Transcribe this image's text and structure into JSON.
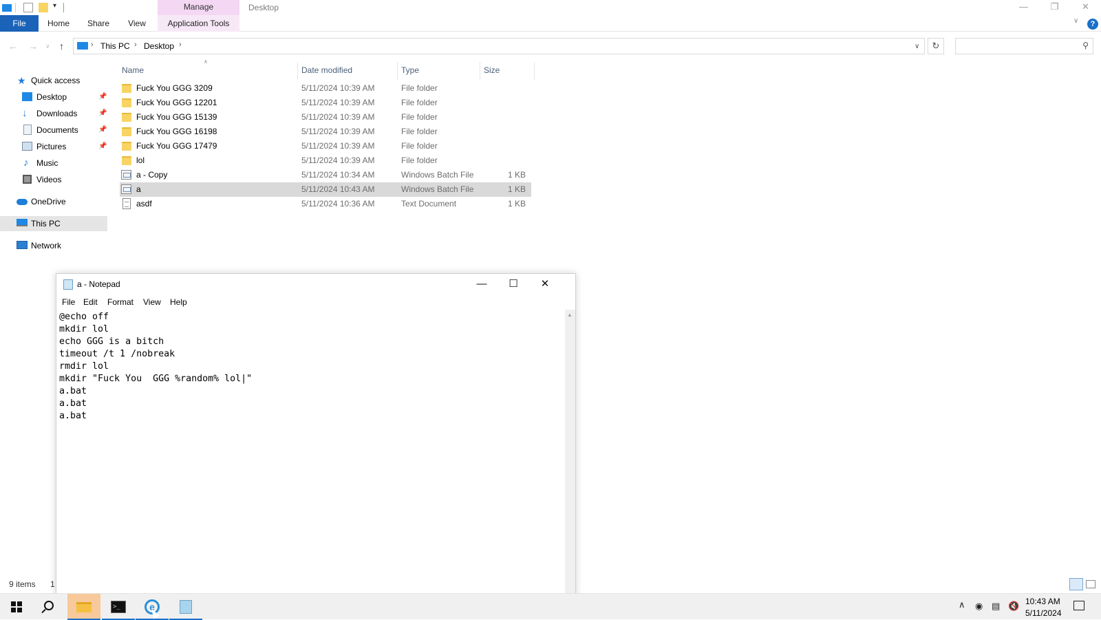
{
  "explorer": {
    "window_title": "Desktop",
    "manage_tab": "Manage",
    "ribbon": {
      "file": "File",
      "home": "Home",
      "share": "Share",
      "view": "View",
      "app_tools": "Application Tools"
    },
    "address": {
      "crumbs": [
        "This PC",
        "Desktop"
      ]
    },
    "search": {
      "placeholder": ""
    },
    "nav": {
      "quick_access": "Quick access",
      "desktop": "Desktop",
      "downloads": "Downloads",
      "documents": "Documents",
      "pictures": "Pictures",
      "music": "Music",
      "videos": "Videos",
      "onedrive": "OneDrive",
      "this_pc": "This PC",
      "network": "Network"
    },
    "columns": {
      "name": "Name",
      "date": "Date modified",
      "type": "Type",
      "size": "Size"
    },
    "files": [
      {
        "name": "Fuck You GGG 3209",
        "date": "5/11/2024 10:39 AM",
        "type": "File folder",
        "size": "",
        "kind": "folder"
      },
      {
        "name": "Fuck You GGG 12201",
        "date": "5/11/2024 10:39 AM",
        "type": "File folder",
        "size": "",
        "kind": "folder"
      },
      {
        "name": "Fuck You GGG 15139",
        "date": "5/11/2024 10:39 AM",
        "type": "File folder",
        "size": "",
        "kind": "folder"
      },
      {
        "name": "Fuck You GGG 16198",
        "date": "5/11/2024 10:39 AM",
        "type": "File folder",
        "size": "",
        "kind": "folder"
      },
      {
        "name": "Fuck You GGG 17479",
        "date": "5/11/2024 10:39 AM",
        "type": "File folder",
        "size": "",
        "kind": "folder"
      },
      {
        "name": "lol",
        "date": "5/11/2024 10:39 AM",
        "type": "File folder",
        "size": "",
        "kind": "folder"
      },
      {
        "name": "a - Copy",
        "date": "5/11/2024 10:34 AM",
        "type": "Windows Batch File",
        "size": "1 KB",
        "kind": "bat"
      },
      {
        "name": "a",
        "date": "5/11/2024 10:43 AM",
        "type": "Windows Batch File",
        "size": "1 KB",
        "kind": "bat"
      },
      {
        "name": "asdf",
        "date": "5/11/2024 10:36 AM",
        "type": "Text Document",
        "size": "1 KB",
        "kind": "txt"
      }
    ],
    "status": {
      "count": "9 items",
      "selected": "1"
    }
  },
  "notepad": {
    "title": "a - Notepad",
    "menu": [
      "File",
      "Edit",
      "Format",
      "View",
      "Help"
    ],
    "content": "@echo off\nmkdir lol\necho GGG is a bitch\ntimeout /t 1 /nobreak\nrmdir lol\nmkdir \"Fuck You  GGG %random% lol|\"\na.bat\na.bat\na.bat"
  },
  "taskbar": {
    "time": "10:43 AM",
    "date": "5/11/2024"
  }
}
